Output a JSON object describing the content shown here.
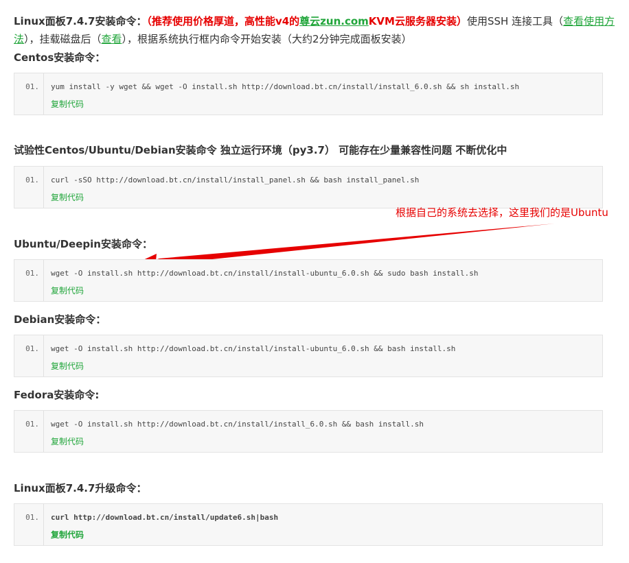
{
  "intro": {
    "part1": "Linux面板7.4.7安装命令：",
    "part2": "（推荐使用价格厚道，高性能v4的",
    "link_zun": "尊云zun.com",
    "part3": "KVM云服务器安装）",
    "part4": "使用SSH 连接工具（",
    "link_usage": "查看使用方法",
    "part5": "），挂载磁盘后（",
    "link_view": "查看",
    "part6": "），根据系统执行框内命令开始安装（大约2分钟完成面板安装）"
  },
  "sections": [
    {
      "title": "Centos安装命令：",
      "line": "01.",
      "code": "yum install -y wget && wget -O install.sh http://download.bt.cn/install/install_6.0.sh && sh install.sh",
      "copy": "复制代码"
    },
    {
      "title": "试验性Centos/Ubuntu/Debian安装命令 独立运行环境（py3.7） 可能存在少量兼容性问题 不断优化中",
      "line": "01.",
      "code": "curl -sSO http://download.bt.cn/install/install_panel.sh && bash install_panel.sh",
      "copy": "复制代码"
    },
    {
      "title": "Ubuntu/Deepin安装命令：",
      "line": "01.",
      "code": "wget -O install.sh http://download.bt.cn/install/install-ubuntu_6.0.sh && sudo bash install.sh",
      "copy": "复制代码"
    },
    {
      "title": "Debian安装命令：",
      "line": "01.",
      "code": "wget -O install.sh http://download.bt.cn/install/install-ubuntu_6.0.sh && bash install.sh",
      "copy": "复制代码"
    },
    {
      "title": "Fedora安装命令:",
      "line": "01.",
      "code": "wget -O install.sh http://download.bt.cn/install/install_6.0.sh && bash install.sh",
      "copy": "复制代码"
    },
    {
      "title": "Linux面板7.4.7升级命令：",
      "line": "01.",
      "code": "curl http://download.bt.cn/install/update6.sh|bash",
      "copy": "复制代码"
    }
  ],
  "annotation": {
    "text": "根据自己的系统去选择，这里我们的是Ubuntu",
    "color": "#e60000"
  },
  "colors": {
    "accent_green": "#20a53a",
    "accent_red": "#e60000"
  }
}
